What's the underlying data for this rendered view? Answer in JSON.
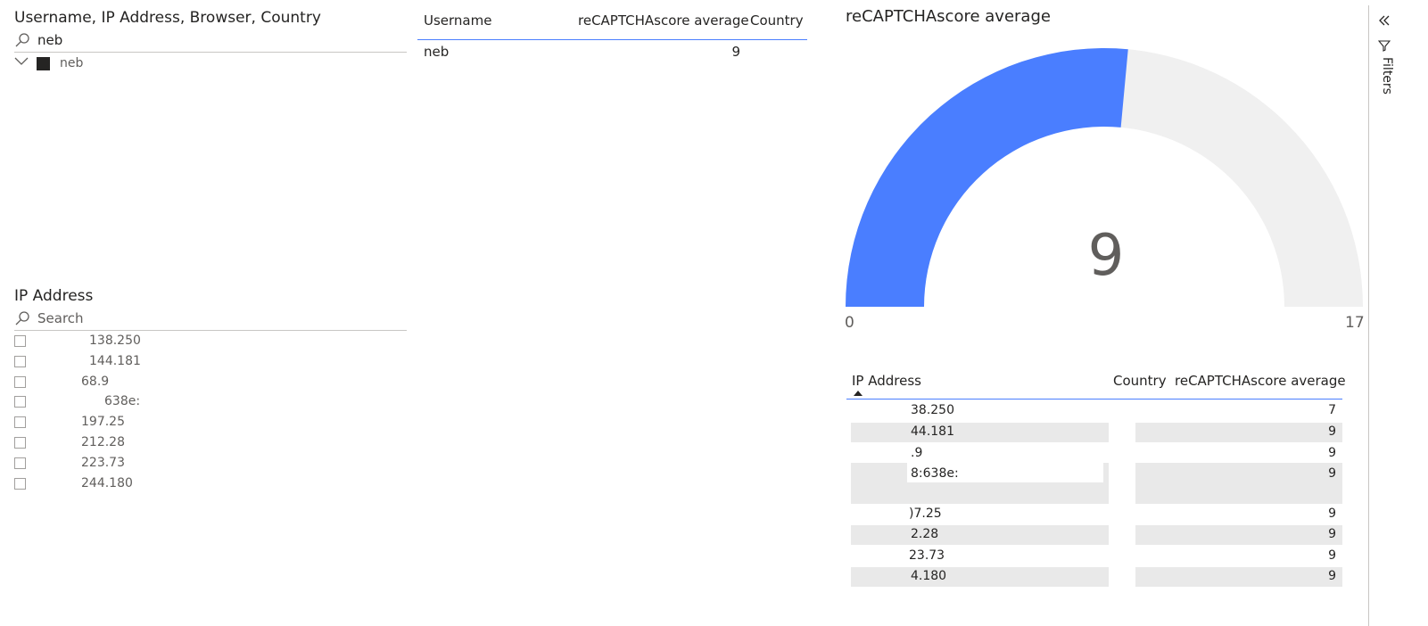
{
  "slicer1": {
    "title": "Username, IP Address, Browser, Country",
    "search_value": "neb",
    "item_label": "neb"
  },
  "table1": {
    "headers": [
      "Username",
      "reCAPTCHAscore average",
      "Country"
    ],
    "row": {
      "username": "neb",
      "score": "9",
      "country": ""
    }
  },
  "gauge": {
    "title": "reCAPTCHAscore average",
    "value": 9,
    "value_label": "9",
    "min": 0,
    "max": 17,
    "min_label": "0",
    "max_label": "17",
    "fill_color": "#4a7eff",
    "track_color": "#f0f0f0"
  },
  "slicer2": {
    "title": "IP Address",
    "search_placeholder": "Search",
    "items": [
      "138.250",
      "144.181",
      "68.9",
      "638e:",
      "197.25",
      "212.28",
      "223.73",
      "244.180"
    ]
  },
  "table2": {
    "headers": [
      "IP Address",
      "Country",
      "reCAPTCHAscore average"
    ],
    "rows": [
      {
        "ip": "38.250",
        "score": "7"
      },
      {
        "ip": "44.181",
        "score": "9"
      },
      {
        "ip": ".9",
        "score": "9"
      },
      {
        "ip": "8:638e:",
        "score": "9"
      },
      {
        "ip": ")7.25",
        "score": "9"
      },
      {
        "ip": "2.28",
        "score": "9"
      },
      {
        "ip": "23.73",
        "score": "9"
      },
      {
        "ip": "4.180",
        "score": "9"
      }
    ]
  },
  "filters_pane": {
    "label": "Filters"
  }
}
